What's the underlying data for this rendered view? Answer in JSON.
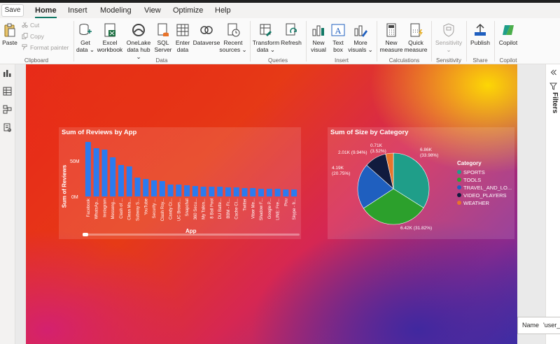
{
  "quick_access": {
    "save_label": "Save"
  },
  "tabs": [
    {
      "label": "Home",
      "active": true
    },
    {
      "label": "Insert"
    },
    {
      "label": "Modeling"
    },
    {
      "label": "View"
    },
    {
      "label": "Optimize"
    },
    {
      "label": "Help"
    }
  ],
  "ribbon": {
    "clipboard": {
      "paste": "Paste",
      "cut": "Cut",
      "copy": "Copy",
      "format_painter": "Format painter",
      "group": "Clipboard"
    },
    "data": {
      "get_data": [
        "Get",
        "data"
      ],
      "excel": [
        "Excel",
        "workbook"
      ],
      "onelake": [
        "OneLake",
        "data hub"
      ],
      "sql": [
        "SQL",
        "Server"
      ],
      "enter": [
        "Enter",
        "data"
      ],
      "dataverse": [
        "Dataverse"
      ],
      "recent": [
        "Recent",
        "sources"
      ],
      "group": "Data"
    },
    "queries": {
      "transform": [
        "Transform",
        "data"
      ],
      "refresh": [
        "Refresh"
      ],
      "group": "Queries"
    },
    "insert": {
      "new_visual": [
        "New",
        "visual"
      ],
      "text_box": [
        "Text",
        "box"
      ],
      "more_visuals": [
        "More",
        "visuals"
      ],
      "group": "Insert"
    },
    "calculations": {
      "new_measure": [
        "New",
        "measure"
      ],
      "quick_measure": [
        "Quick",
        "measure"
      ],
      "group": "Calculations"
    },
    "sensitivity": {
      "label": "Sensitivity",
      "group": "Sensitivity"
    },
    "share": {
      "publish": "Publish",
      "group": "Share"
    },
    "copilot": {
      "label": "Copilot",
      "group": "Copilot"
    }
  },
  "accent_color": "#117865",
  "filters_pane": {
    "label": "Filters"
  },
  "name_box": {
    "label": "Name",
    "value": "'user_r"
  },
  "chart_data": [
    {
      "type": "bar",
      "title": "Sum of Reviews by App",
      "xlabel": "App",
      "ylabel": "Sum of Reviews",
      "yticks": [
        "50M",
        "0M"
      ],
      "ylim": [
        0,
        80
      ],
      "bar_color": "#2b7bef",
      "categories": [
        "Facebook",
        "WhatsAp...",
        "Instagram",
        "Messeng...",
        "Clash of ...",
        "Clean Ma...",
        "Subway S...",
        "YouTube",
        "Security ...",
        "Clash Roy...",
        "Candy Cr...",
        "UC Brows...",
        "Snapchat",
        "360 Secu...",
        "My Talkin...",
        "8 Ball Pool",
        "DU Batte...",
        "BBM - Fr...",
        "Cache Cl...",
        "Twitter",
        "Viber Me...",
        "Shadow F...",
        "Google P...",
        "LINE: Fre...",
        "Pou",
        "Skype - fr..."
      ],
      "values": [
        78,
        69,
        67,
        56,
        45,
        43,
        27,
        25,
        23,
        22,
        17,
        17,
        16,
        15,
        14,
        14,
        14,
        13,
        13,
        12,
        12,
        11,
        11,
        11,
        10,
        10
      ]
    },
    {
      "type": "pie",
      "title": "Sum of Size by Category",
      "legend_title": "Category",
      "legend_position": "right",
      "categories": [
        "SPORTS",
        "TOOLS",
        "TRAVEL_AND_LO...",
        "VIDEO_PLAYERS",
        "WEATHER"
      ],
      "values": [
        6.86,
        6.42,
        4.19,
        2.01,
        0.71
      ],
      "labels": [
        "6.86K (33.98%)",
        "6.42K (31.82%)",
        "4.19K (20.75%)",
        "2.01K (9.94%)",
        "0.71K (3.52%)"
      ],
      "colors": [
        "#1f9e89",
        "#2ca02c",
        "#1f5fbf",
        "#111b3e",
        "#e8742c"
      ]
    }
  ]
}
